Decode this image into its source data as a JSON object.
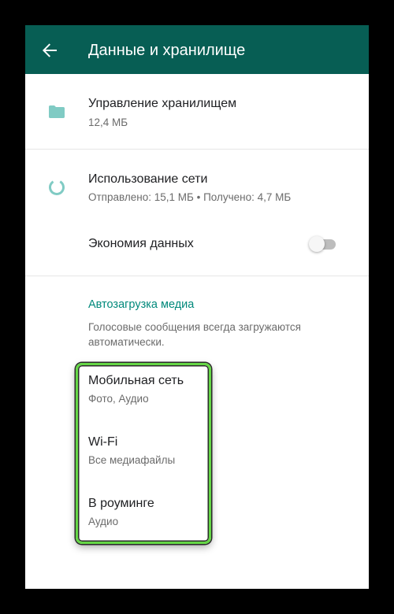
{
  "appbar": {
    "title": "Данные и хранилище",
    "back_icon": "arrow-back-icon",
    "background": "#075e54"
  },
  "storage": {
    "icon": "folder-icon",
    "title": "Управление хранилищем",
    "subtitle": "12,4 МБ"
  },
  "network": {
    "icon": "data-usage-icon",
    "title": "Использование сети",
    "subtitle": "Отправлено: 15,1 МБ • Получено: 4,7 МБ"
  },
  "data_saver": {
    "title": "Экономия данных",
    "enabled": false
  },
  "media_autodownload": {
    "header": "Автозагрузка медиа",
    "description": "Голосовые сообщения всегда загружаются автоматически.",
    "items": [
      {
        "title": "Мобильная сеть",
        "subtitle": "Фото, Аудио"
      },
      {
        "title": "Wi-Fi",
        "subtitle": "Все медиафайлы"
      },
      {
        "title": "В роуминге",
        "subtitle": "Аудио"
      }
    ]
  },
  "colors": {
    "accent": "#00897b",
    "icon_teal": "#80cbc4",
    "highlight": "#65d646"
  }
}
